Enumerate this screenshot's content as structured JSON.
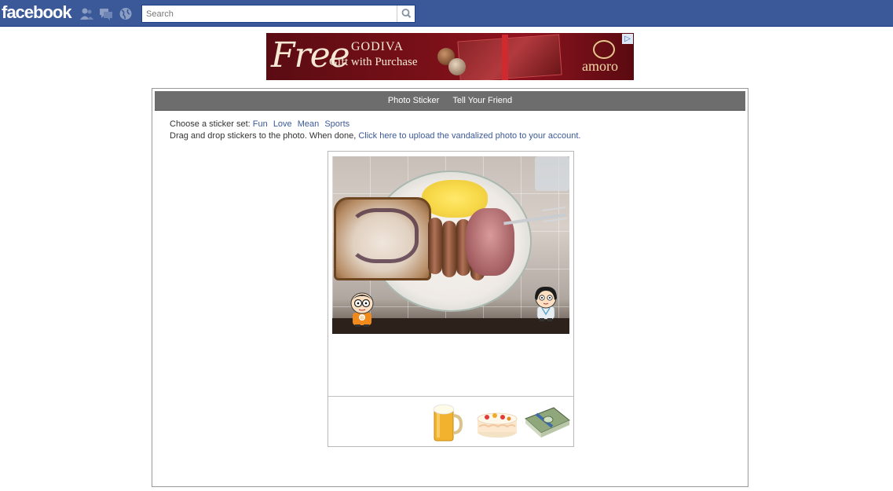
{
  "topbar": {
    "logo": "facebook",
    "search_placeholder": "Search"
  },
  "ad": {
    "headline": "Free",
    "brand": "GODIVA",
    "offer": "Gift with Purchase",
    "advertiser": "amoro",
    "ad_choices": "▷"
  },
  "app": {
    "nav": [
      "Photo Sticker",
      "Tell Your Friend"
    ],
    "sticker_prompt": "Choose a sticker set:",
    "sticker_sets": [
      "Fun",
      "Love",
      "Mean",
      "Sports"
    ],
    "drag_text": "Drag and drop stickers to the photo. When done,",
    "upload_link": "Click here to upload the vandalized photo to your account."
  },
  "stickers": [
    "beer-mug-sticker",
    "birthday-cake-sticker",
    "money-stack-sticker"
  ],
  "colors": {
    "facebook_blue": "#3b5998",
    "nav_gray": "#6d6d6d",
    "link": "#3b5998"
  }
}
